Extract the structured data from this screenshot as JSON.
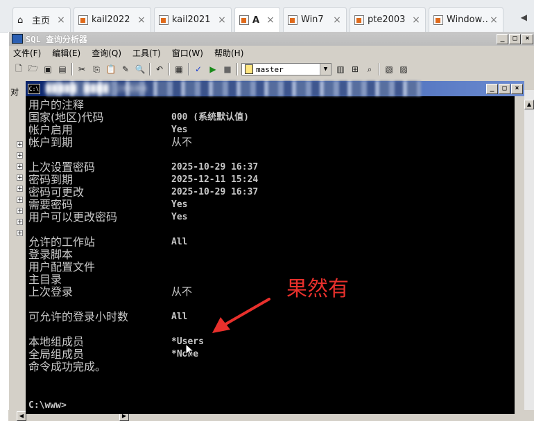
{
  "tabs": [
    {
      "label": "主页",
      "icon": "home-icon",
      "active": false
    },
    {
      "label": "kail2022",
      "icon": "vm-icon",
      "active": false
    },
    {
      "label": "kail2021",
      "icon": "vm-icon",
      "active": false
    },
    {
      "label": "A",
      "icon": "vm-running-icon",
      "active": true
    },
    {
      "label": "Win7",
      "icon": "vm-icon",
      "active": false
    },
    {
      "label": "pte2003",
      "icon": "vm-icon",
      "active": false
    },
    {
      "label": "Window…",
      "icon": "vm-icon",
      "active": false
    }
  ],
  "sql_window": {
    "title": "SQL 查询分析器",
    "menu": [
      "文件(F)",
      "编辑(E)",
      "查询(Q)",
      "工具(T)",
      "窗口(W)",
      "帮助(H)"
    ],
    "database": "master",
    "left_label": "对"
  },
  "cmd": {
    "title_redacted": "█████ ████ 20604",
    "rows": [
      {
        "label": "用户的注释",
        "value": ""
      },
      {
        "label": "国家(地区)代码",
        "value": "000 (系统默认值)"
      },
      {
        "label": "帐户启用",
        "value": "Yes"
      },
      {
        "label": "帐户到期",
        "value": "从不"
      },
      {
        "label": "上次设置密码",
        "value": "2025-10-29 16:37"
      },
      {
        "label": "密码到期",
        "value": "2025-12-11 15:24"
      },
      {
        "label": "密码可更改",
        "value": "2025-10-29 16:37"
      },
      {
        "label": "需要密码",
        "value": "Yes"
      },
      {
        "label": "用户可以更改密码",
        "value": "Yes"
      },
      {
        "label": "允许的工作站",
        "value": "All"
      },
      {
        "label": "登录脚本",
        "value": ""
      },
      {
        "label": "用户配置文件",
        "value": ""
      },
      {
        "label": "主目录",
        "value": ""
      },
      {
        "label": "上次登录",
        "value": "从不"
      },
      {
        "label": "可允许的登录小时数",
        "value": "All"
      },
      {
        "label": "本地组成员",
        "value": "*Users"
      },
      {
        "label": "全局组成员",
        "value": "*None"
      },
      {
        "label": "命令成功完成。",
        "value": ""
      }
    ],
    "prompt": "C:\\www>"
  },
  "annotation": {
    "text": "果然有",
    "color": "#e8302c"
  }
}
